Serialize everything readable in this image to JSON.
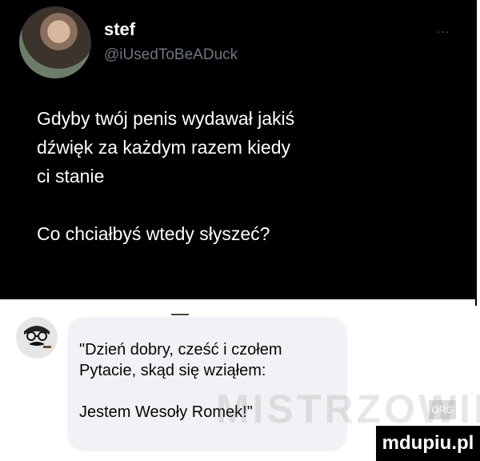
{
  "tweet": {
    "name": "stef",
    "handle": "@iUsedToBeADuck",
    "more_glyph": "...",
    "lines": [
      "Gdyby twój penis wydawał jakiś",
      "dźwięk za każdym razem kiedy",
      "ci stanie",
      "",
      "Co chciałbyś wtedy słyszeć?"
    ]
  },
  "reply": {
    "lines": [
      "\"Dzień dobry, cześć i czołem",
      "Pytacie, skąd się wziąłem:",
      "",
      "Jestem Wesoły Romek!\""
    ]
  },
  "watermark": {
    "text": "MISTRZOWIE",
    "suffix": "ORG"
  },
  "site_badge": "mdupiu.pl",
  "colors": {
    "tweet_bg": "#000000",
    "bubble_bg": "#f0f2f5",
    "handle": "#6e767d"
  }
}
